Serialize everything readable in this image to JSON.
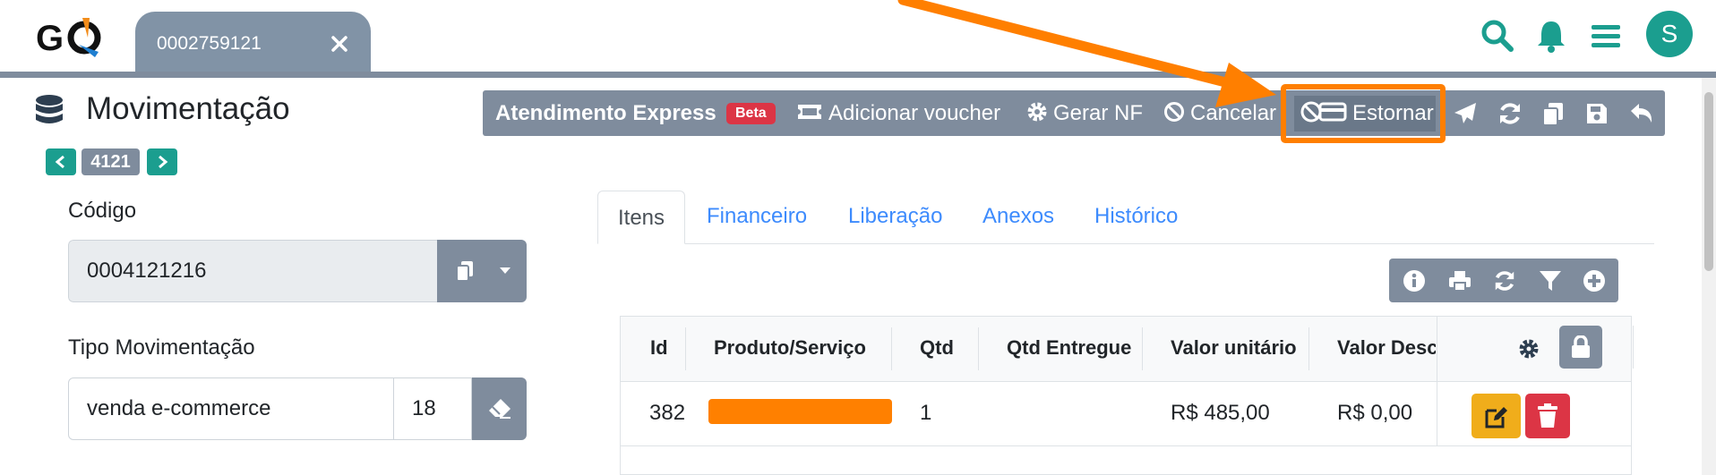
{
  "app": {
    "logo_text": "GO"
  },
  "tab": {
    "label": "0002759121"
  },
  "user": {
    "avatar_letter": "S",
    "avatar_color": "#1b9e8f"
  },
  "page": {
    "title": "Movimentação",
    "record_number": "4121"
  },
  "toolbar": {
    "express_label": "Atendimento Express",
    "beta_badge": "Beta",
    "voucher_label": "Adicionar voucher",
    "gerar_nf_label": "Gerar NF",
    "cancelar_label": "Cancelar",
    "estornar_label": "Estornar",
    "icons": [
      "send-icon",
      "refresh-icon",
      "copy-icon",
      "save-icon",
      "undo-icon"
    ]
  },
  "form": {
    "codigo_label": "Código",
    "codigo_value": "0004121216",
    "tipo_label": "Tipo Movimentação",
    "tipo_value": "venda e-commerce",
    "tipo_code": "18"
  },
  "tabs": [
    {
      "label": "Itens",
      "active": true
    },
    {
      "label": "Financeiro"
    },
    {
      "label": "Liberação"
    },
    {
      "label": "Anexos"
    },
    {
      "label": "Histórico"
    }
  ],
  "table": {
    "columns": [
      "Id",
      "Produto/Serviço",
      "Qtd",
      "Qtd Entregue",
      "Valor unitário",
      "Valor Desc"
    ],
    "rows": [
      {
        "id": "382",
        "produto": "",
        "qtd": "1",
        "qtd_entregue": "",
        "valor_unitario": "R$ 485,00",
        "valor_desc": "R$ 0,00"
      }
    ]
  },
  "colors": {
    "accent": "#1b9e8f",
    "toolbar": "#7f8c9d",
    "highlight": "#ff7f00",
    "danger": "#dc3545",
    "warning": "#f0ad1b",
    "link": "#3d8bfd"
  }
}
